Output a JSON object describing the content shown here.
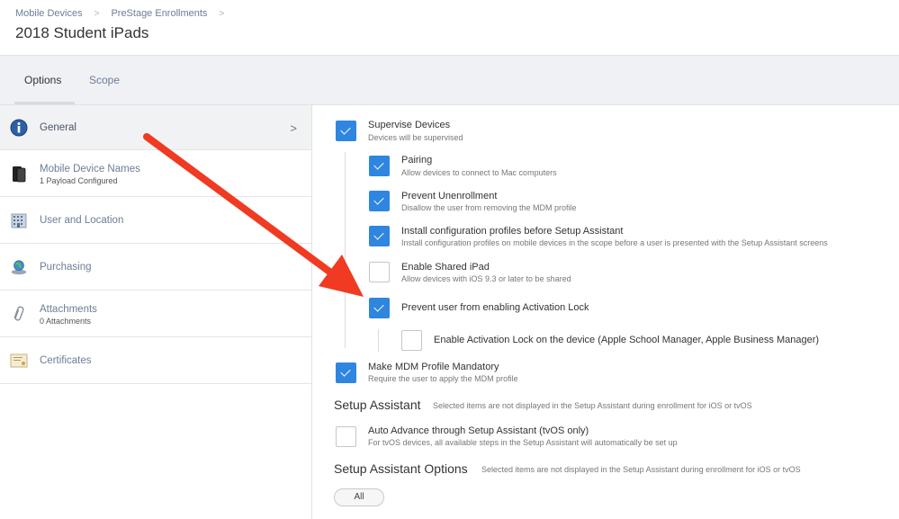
{
  "header": {
    "breadcrumb": [
      "Mobile Devices",
      "PreStage Enrollments"
    ],
    "title": "2018 Student iPads"
  },
  "tabs": [
    {
      "label": "Options",
      "active": true
    },
    {
      "label": "Scope",
      "active": false
    }
  ],
  "sidebar": {
    "items": [
      {
        "label": "General",
        "sub": "",
        "icon": "info-icon",
        "active": true
      },
      {
        "label": "Mobile Device Names",
        "sub": "1 Payload Configured",
        "icon": "mobile-device-icon"
      },
      {
        "label": "User and Location",
        "sub": "",
        "icon": "building-icon"
      },
      {
        "label": "Purchasing",
        "sub": "",
        "icon": "globe-icon"
      },
      {
        "label": "Attachments",
        "sub": "0 Attachments",
        "icon": "paperclip-icon"
      },
      {
        "label": "Certificates",
        "sub": "",
        "icon": "certificate-icon"
      }
    ]
  },
  "options": [
    {
      "label": "Supervise Devices",
      "sub": "Devices will be supervised",
      "checked": true
    },
    {
      "label": "Pairing",
      "sub": "Allow devices to connect to Mac computers",
      "checked": true
    },
    {
      "label": "Prevent Unenrollment",
      "sub": "Disallow the user from removing the MDM profile",
      "checked": true
    },
    {
      "label": "Install configuration profiles before Setup Assistant",
      "sub": "Install configuration profiles on mobile devices in the scope before a user is presented with the Setup Assistant screens",
      "checked": true
    },
    {
      "label": "Enable Shared iPad",
      "sub": "Allow devices with iOS 9.3 or later to be shared",
      "checked": false
    },
    {
      "label": "Prevent user from enabling Activation Lock",
      "sub": "",
      "checked": true
    },
    {
      "label": "Enable Activation Lock on the device (Apple School Manager, Apple Business Manager)",
      "sub": "",
      "checked": false
    },
    {
      "label": "Make MDM Profile Mandatory",
      "sub": "Require the user to apply the MDM profile",
      "checked": true
    },
    {
      "label": "Auto Advance through Setup Assistant (tvOS only)",
      "sub": "For tvOS devices, all available steps in the Setup Assistant will automatically be set up",
      "checked": false
    }
  ],
  "setup_assistant": {
    "title": "Setup Assistant",
    "desc": "Selected items are not displayed in the Setup Assistant during enrollment for iOS or tvOS"
  },
  "setup_assistant_options": {
    "title": "Setup Assistant Options",
    "desc": "Selected items are not displayed in the Setup Assistant during enrollment for iOS or tvOS",
    "all_button": "All"
  },
  "colors": {
    "checkbox_checked": "#2f86e0",
    "annotation_arrow": "#f03a22",
    "tabbar_bg": "#eff1f4"
  }
}
